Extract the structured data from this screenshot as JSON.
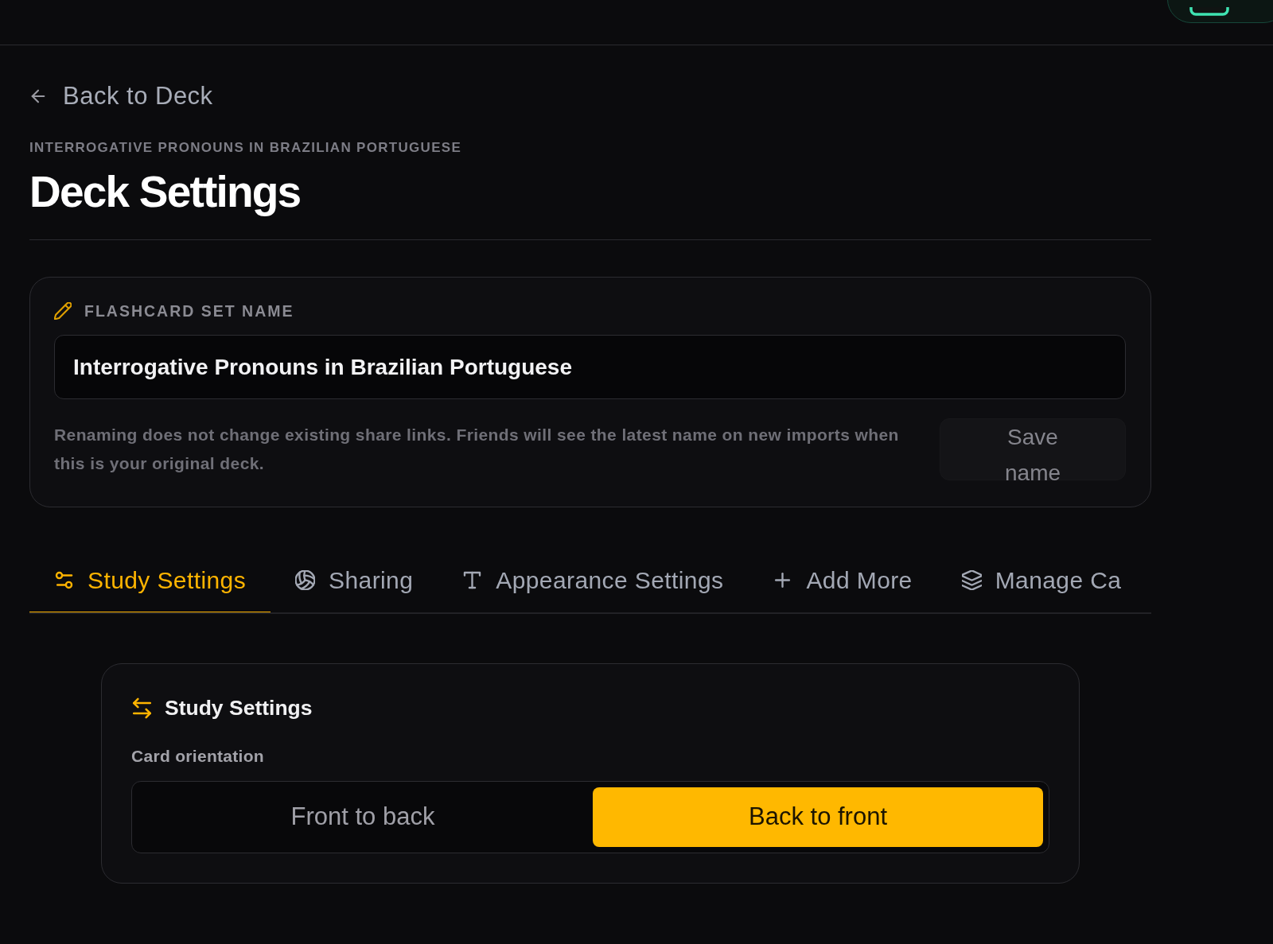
{
  "back_link": {
    "label": "Back to Deck"
  },
  "page": {
    "eyebrow": "INTERROGATIVE PRONOUNS IN BRAZILIAN PORTUGUESE",
    "title": "Deck Settings"
  },
  "name_card": {
    "label": "FLASHCARD SET NAME",
    "input": {
      "value": "Interrogative Pronouns in Brazilian Portuguese"
    },
    "help": "Renaming does not change existing share links. Friends will see the latest name on new imports when this is your original deck.",
    "save_button": {
      "label": "Save name",
      "disabled": true
    }
  },
  "tabs": [
    {
      "label": "Study Settings",
      "selected": true
    },
    {
      "label": "Sharing",
      "selected": false
    },
    {
      "label": "Appearance Settings",
      "selected": false
    },
    {
      "label": "Add More",
      "selected": false
    },
    {
      "label": "Manage Ca",
      "selected": false
    }
  ],
  "panel": {
    "title": "Study Settings",
    "field_label": "Card orientation",
    "options": [
      {
        "label": "Front to back",
        "selected": false
      },
      {
        "label": "Back to front",
        "selected": true
      }
    ]
  }
}
